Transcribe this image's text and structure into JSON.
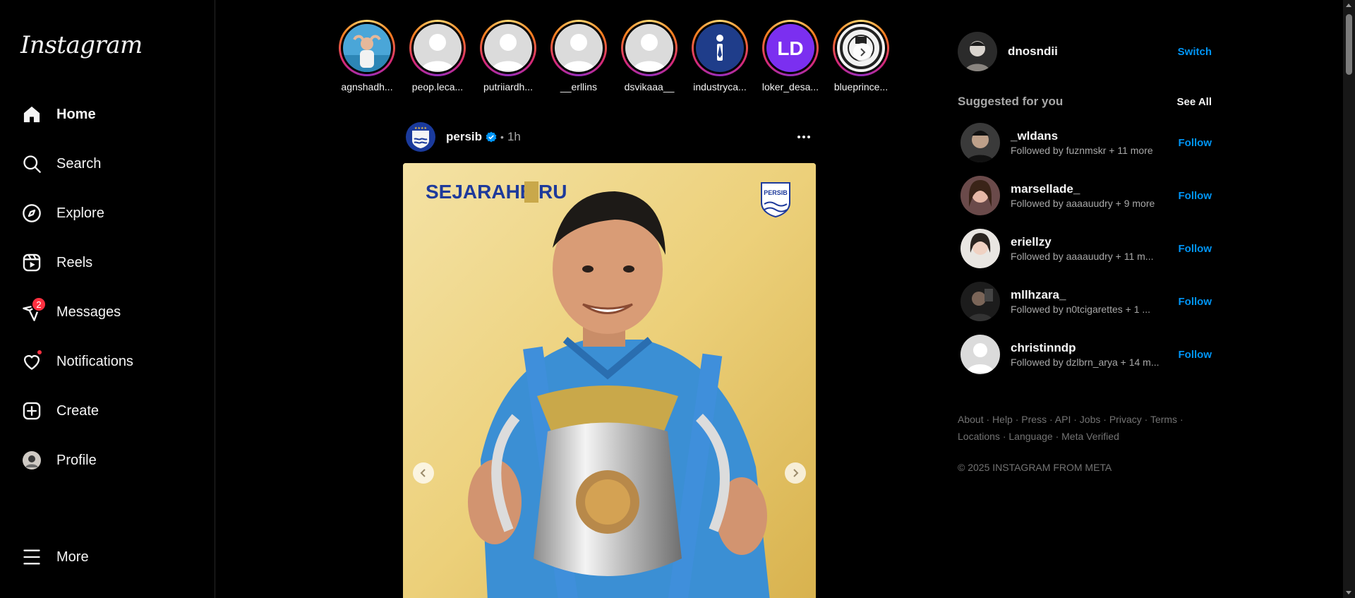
{
  "sidebar": {
    "logo": "Instagram",
    "items": [
      {
        "label": "Home",
        "icon": "home-icon"
      },
      {
        "label": "Search",
        "icon": "search-icon"
      },
      {
        "label": "Explore",
        "icon": "compass-icon"
      },
      {
        "label": "Reels",
        "icon": "reels-icon"
      },
      {
        "label": "Messages",
        "icon": "messenger-icon",
        "badge": "2"
      },
      {
        "label": "Notifications",
        "icon": "heart-icon"
      },
      {
        "label": "Create",
        "icon": "plus-square-icon"
      },
      {
        "label": "Profile",
        "icon": "profile-avatar"
      },
      {
        "label": "More",
        "icon": "hamburger-icon"
      }
    ]
  },
  "stories": [
    {
      "name": "agnshadh..."
    },
    {
      "name": "peop.leca..."
    },
    {
      "name": "putriiardh..."
    },
    {
      "name": "__erllins"
    },
    {
      "name": "dsvikaaa__"
    },
    {
      "name": "industryca..."
    },
    {
      "name": "loker_desa..."
    },
    {
      "name": "blueprince..."
    }
  ],
  "post": {
    "username": "persib",
    "separator": "•",
    "time": "1h",
    "image_text_left": "SEJARAHB  RU",
    "image_badge": "PERSIB"
  },
  "right": {
    "username": "dnosndii",
    "switch_label": "Switch",
    "suggested_title": "Suggested for you",
    "see_all": "See All",
    "suggestions": [
      {
        "name": "_wldans",
        "sub": "Followed by fuznmskr + 11 more",
        "action": "Follow"
      },
      {
        "name": "marsellade_",
        "sub": "Followed by aaaauudry + 9 more",
        "action": "Follow"
      },
      {
        "name": "eriellzy",
        "sub": "Followed by aaaauudry + 11 m...",
        "action": "Follow"
      },
      {
        "name": "mllhzara_",
        "sub": "Followed by n0tcigarettes + 1 ...",
        "action": "Follow"
      },
      {
        "name": "christinndp",
        "sub": "Followed by dzlbrn_arya + 14 m...",
        "action": "Follow"
      }
    ],
    "footer": [
      "About",
      "Help",
      "Press",
      "API",
      "Jobs",
      "Privacy",
      "Terms",
      "Locations",
      "Language",
      "Meta Verified"
    ],
    "copyright": "© 2025 INSTAGRAM FROM META"
  },
  "colors": {
    "background": "#000000",
    "accent_blue": "#0095f6",
    "badge_red": "#ff3040",
    "muted_text": "#a8a8a8",
    "post_bg_gold": "#ecd07a",
    "jersey_blue": "#3b8fd4"
  }
}
